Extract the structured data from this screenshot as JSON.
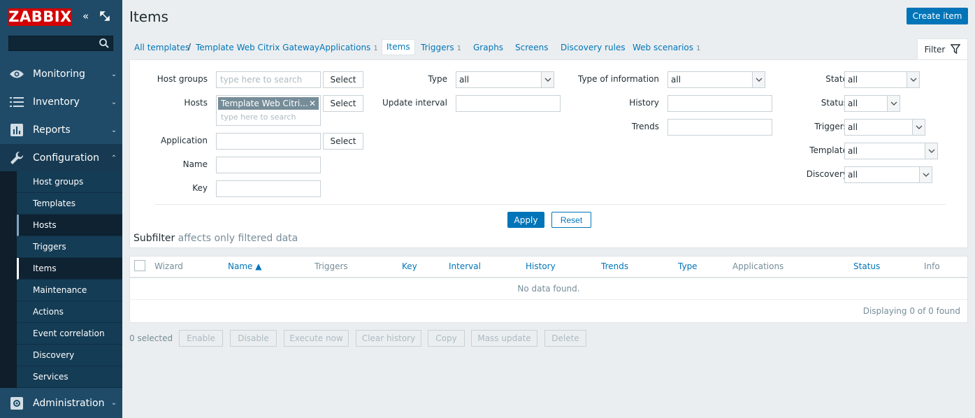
{
  "sidebar": {
    "logo": "ZABBIX",
    "collapse_icon": "«",
    "kiosk_icon": "⤢",
    "search_placeholder": "",
    "menu": {
      "monitoring": "Monitoring",
      "inventory": "Inventory",
      "reports": "Reports",
      "configuration": "Configuration",
      "administration": "Administration"
    },
    "submenu": [
      "Host groups",
      "Templates",
      "Hosts",
      "Triggers",
      "Items",
      "Maintenance",
      "Actions",
      "Event correlation",
      "Discovery",
      "Services"
    ]
  },
  "header": {
    "title": "Items",
    "create_button": "Create item"
  },
  "breadcrumbs": {
    "all_templates": "All templates",
    "separator": "/",
    "template": "Template Web Citrix Gateway",
    "applications": "Applications",
    "applications_count": "1",
    "items": "Items",
    "triggers": "Triggers",
    "triggers_count": "1",
    "graphs": "Graphs",
    "screens": "Screens",
    "discovery_rules": "Discovery rules",
    "web_scenarios": "Web scenarios",
    "web_scenarios_count": "1",
    "filter_tab": "Filter"
  },
  "filter": {
    "host_groups_label": "Host groups",
    "host_groups_placeholder": "type here to search",
    "hosts_label": "Hosts",
    "host_chip": "Template Web Citri...",
    "hosts_placeholder": "type here to search",
    "application_label": "Application",
    "name_label": "Name",
    "key_label": "Key",
    "select_button": "Select",
    "type_label": "Type",
    "type_value": "all",
    "update_interval_label": "Update interval",
    "type_of_information_label": "Type of information",
    "type_of_information_value": "all",
    "history_label": "History",
    "trends_label": "Trends",
    "state_label": "State",
    "state_value": "all",
    "status_label": "Status",
    "status_value": "all",
    "triggers_label": "Triggers",
    "triggers_value": "all",
    "template_label": "Template",
    "template_value": "all",
    "discovery_label": "Discovery",
    "discovery_value": "all",
    "apply_button": "Apply",
    "reset_button": "Reset",
    "subfilter_title": "Subfilter",
    "subfilter_note": "affects only filtered data"
  },
  "table": {
    "columns": {
      "wizard": "Wizard",
      "name": "Name ▲",
      "triggers": "Triggers",
      "key": "Key",
      "interval": "Interval",
      "history": "History",
      "trends": "Trends",
      "type": "Type",
      "applications": "Applications",
      "status": "Status",
      "info": "Info"
    },
    "no_data": "No data found.",
    "displaying": "Displaying 0 of 0 found"
  },
  "actions": {
    "selected": "0 selected",
    "enable": "Enable",
    "disable": "Disable",
    "execute_now": "Execute now",
    "clear_history": "Clear history",
    "copy": "Copy",
    "mass_update": "Mass update",
    "delete": "Delete"
  }
}
